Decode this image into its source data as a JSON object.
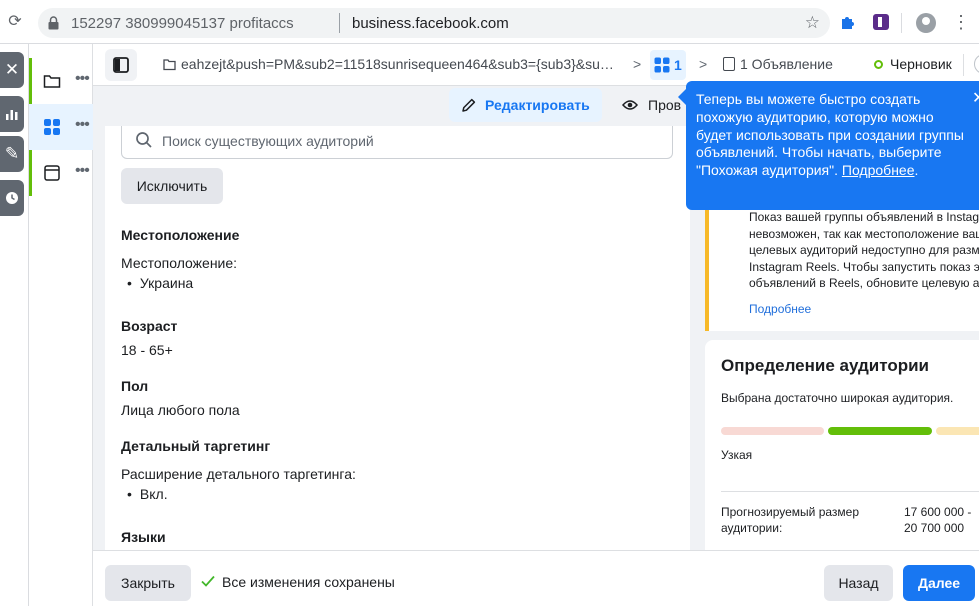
{
  "browser": {
    "url_prefix": "152297 380999045137 profitaccs",
    "url_domain": "business.facebook.com",
    "icons": [
      "reload-icon",
      "lock-icon",
      "star-icon",
      "puzzle-icon",
      "extension-app-icon",
      "profile-icon",
      "kebab-icon"
    ]
  },
  "rail": {
    "items": [
      {
        "icon": "close-icon",
        "glyph": "✕"
      },
      {
        "icon": "chart-icon",
        "glyph": ""
      },
      {
        "icon": "pencil-icon",
        "glyph": "✎"
      },
      {
        "icon": "clock-icon",
        "glyph": ""
      }
    ]
  },
  "tree": {
    "more_glyph": "•••",
    "items": [
      {
        "icon": "folder-icon"
      },
      {
        "icon": "grid-icon"
      },
      {
        "icon": "ad-icon"
      }
    ]
  },
  "topbar": {
    "campaign_crumb": "eahzejt&push=PM&sub2=11518sunrisequeen464&sub3={sub3}&sub...",
    "chevron": ">",
    "adset_crumb": "1",
    "ad_crumb": "1 Объявление",
    "status": "Черновик"
  },
  "actions": {
    "edit": "Редактировать",
    "preview": "Пров"
  },
  "form": {
    "search_placeholder": "Поиск существующих аудиторий",
    "search_value": "",
    "exclude": "Исключить",
    "location_title": "Местоположение",
    "location_label": "Местоположение:",
    "location_value": "Украина",
    "age_title": "Возраст",
    "age_value": "18 - 65+",
    "gender_title": "Пол",
    "gender_value": "Лица любого пола",
    "detailed_title": "Детальный таргетинг",
    "detailed_label": "Расширение детального таргетинга:",
    "detailed_value": "Вкл.",
    "languages_title": "Языки"
  },
  "warning": {
    "lines": [
      "Показ вашей группы объявлений в Instagram",
      "невозможен, так как местоположение ваш",
      "целевых аудиторий недоступно для разм",
      "Instagram Reels. Чтобы запустить показ э",
      "объявлений в Reels, обновите целевую ау"
    ],
    "link": "Подробнее",
    "accent_color": "#f7b928"
  },
  "audience": {
    "title": "Определение аудитории",
    "subtitle": "Выбрана достаточно широкая аудитория.",
    "meter": {
      "segments": [
        {
          "color": "#f8d9d4"
        },
        {
          "color": "#63be09"
        },
        {
          "color": "#fbe6b4"
        }
      ],
      "active_segment": 2
    },
    "narrow_label": "Узкая",
    "estimate_label": "Прогнозируемый размер аудитории:",
    "estimate_value": "17 600 000 - 20 700 000"
  },
  "tooltip": {
    "text": "Теперь вы можете быстро создать похожую аудиторию, которую можно будет использовать при создании группы объявлений. Чтобы начать, выберите \"Похожая аудитория\". ",
    "link": "Подробнее",
    "period": ".",
    "close_glyph": "✕",
    "color": "#1877f2"
  },
  "footer": {
    "close": "Закрыть",
    "saved": "Все изменения сохранены",
    "back": "Назад",
    "next": "Далее",
    "accent_color": "#1877f2",
    "success_color": "#42b72a"
  }
}
